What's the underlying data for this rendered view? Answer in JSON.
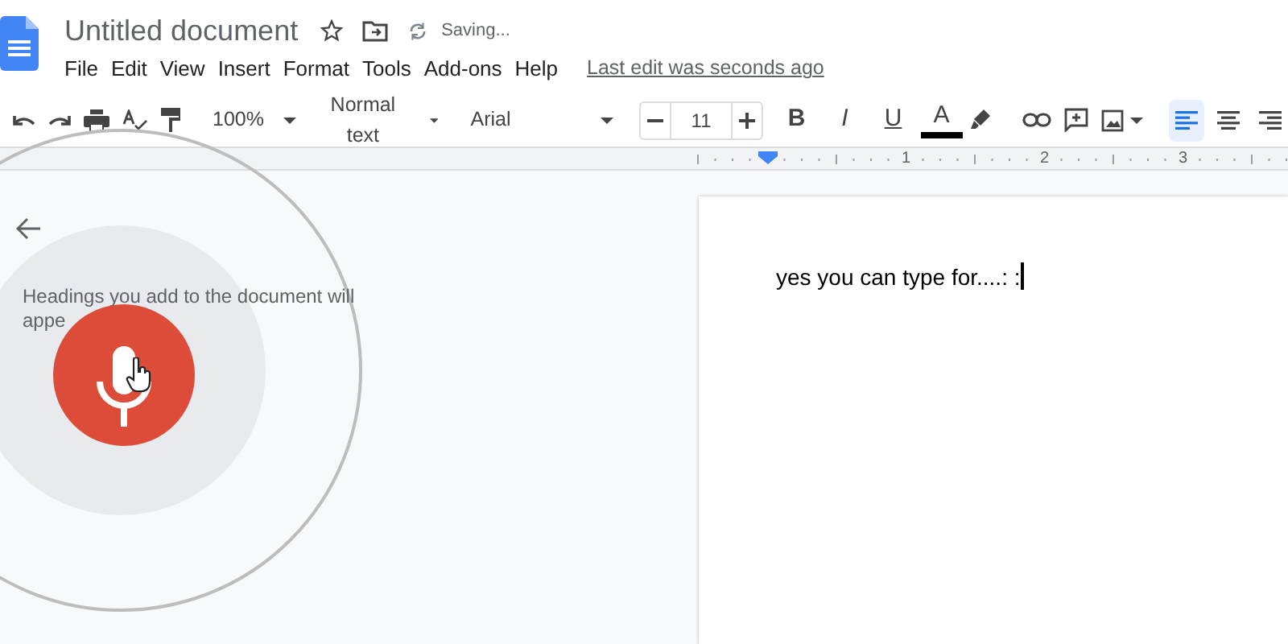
{
  "document": {
    "title": "Untitled document",
    "save_status": "Saving...",
    "last_edit": "Last edit was seconds ago",
    "body_text": "yes you can type for....: :"
  },
  "menu": [
    "File",
    "Edit",
    "View",
    "Insert",
    "Format",
    "Tools",
    "Add-ons",
    "Help"
  ],
  "toolbar": {
    "zoom": "100%",
    "style": "Normal text",
    "font": "Arial",
    "font_size": "11",
    "format_buttons": [
      {
        "label": "B",
        "kind": "bold"
      },
      {
        "label": "I",
        "kind": "italic"
      },
      {
        "label": "U",
        "kind": "underline"
      },
      {
        "label": "A",
        "kind": "color"
      }
    ],
    "alignment": [
      {
        "selected": true
      },
      {
        "selected": false
      },
      {
        "selected": false
      }
    ]
  },
  "ruler": {
    "numbers": [
      "1",
      "2",
      "3"
    ]
  },
  "outline": {
    "hint": "Headings you add to the document will appe"
  }
}
